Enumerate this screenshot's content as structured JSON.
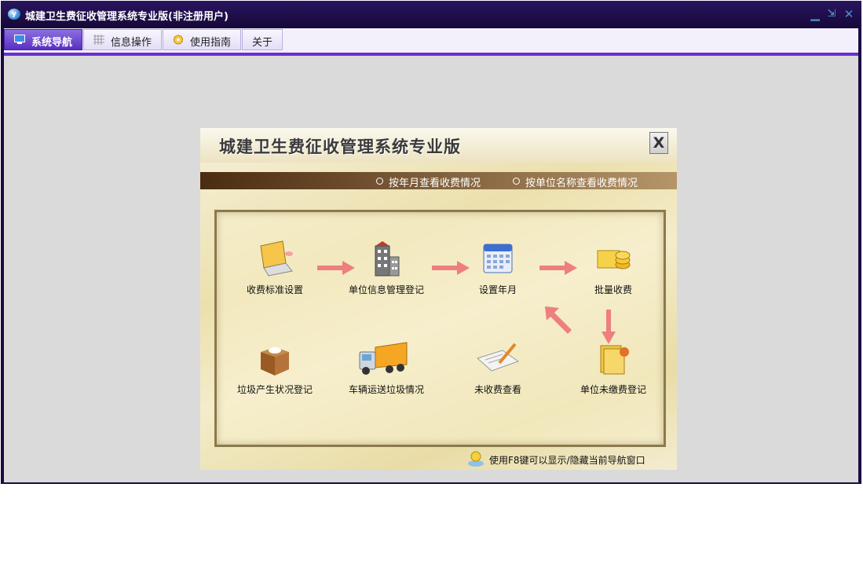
{
  "window": {
    "title": "城建卫生费征收管理系统专业版(非注册用户)",
    "buttons": {
      "minimize": "minimize-icon",
      "restore": "restore-icon",
      "close": "close-icon"
    }
  },
  "menu": {
    "tabs": [
      {
        "label": "系统导航",
        "icon": "monitor-icon",
        "active": true
      },
      {
        "label": "信息操作",
        "icon": "grid-icon",
        "active": false
      },
      {
        "label": "使用指南",
        "icon": "compass-icon",
        "active": false
      },
      {
        "label": "关于",
        "icon": "",
        "active": false
      }
    ]
  },
  "panel": {
    "title": "城建卫生费征收管理系统专业版",
    "close_label": "X",
    "options": [
      {
        "label": "按年月查看收费情况"
      },
      {
        "label": "按单位名称查看收费情况"
      }
    ],
    "nodes": [
      {
        "label": "收费标准设置",
        "icon": "laptop-pen-icon"
      },
      {
        "label": "单位信息管理登记",
        "icon": "building-icon"
      },
      {
        "label": "设置年月",
        "icon": "calendar-icon"
      },
      {
        "label": "批量收费",
        "icon": "coins-icon"
      },
      {
        "label": "垃圾产生状况登记",
        "icon": "box-icon"
      },
      {
        "label": "车辆运送垃圾情况",
        "icon": "truck-icon"
      },
      {
        "label": "未收费查看",
        "icon": "paper-pen-icon"
      },
      {
        "label": "单位未缴费登记",
        "icon": "folder-icon"
      }
    ],
    "hint": "使用F8键可以显示/隐藏当前导航窗口"
  },
  "colors": {
    "titlebar": "#1c0a45",
    "active_tab": "#5a2fc3",
    "menu_line": "#6a2fd0",
    "arrow": "#ee7f7f",
    "client_bg": "#dadada"
  }
}
